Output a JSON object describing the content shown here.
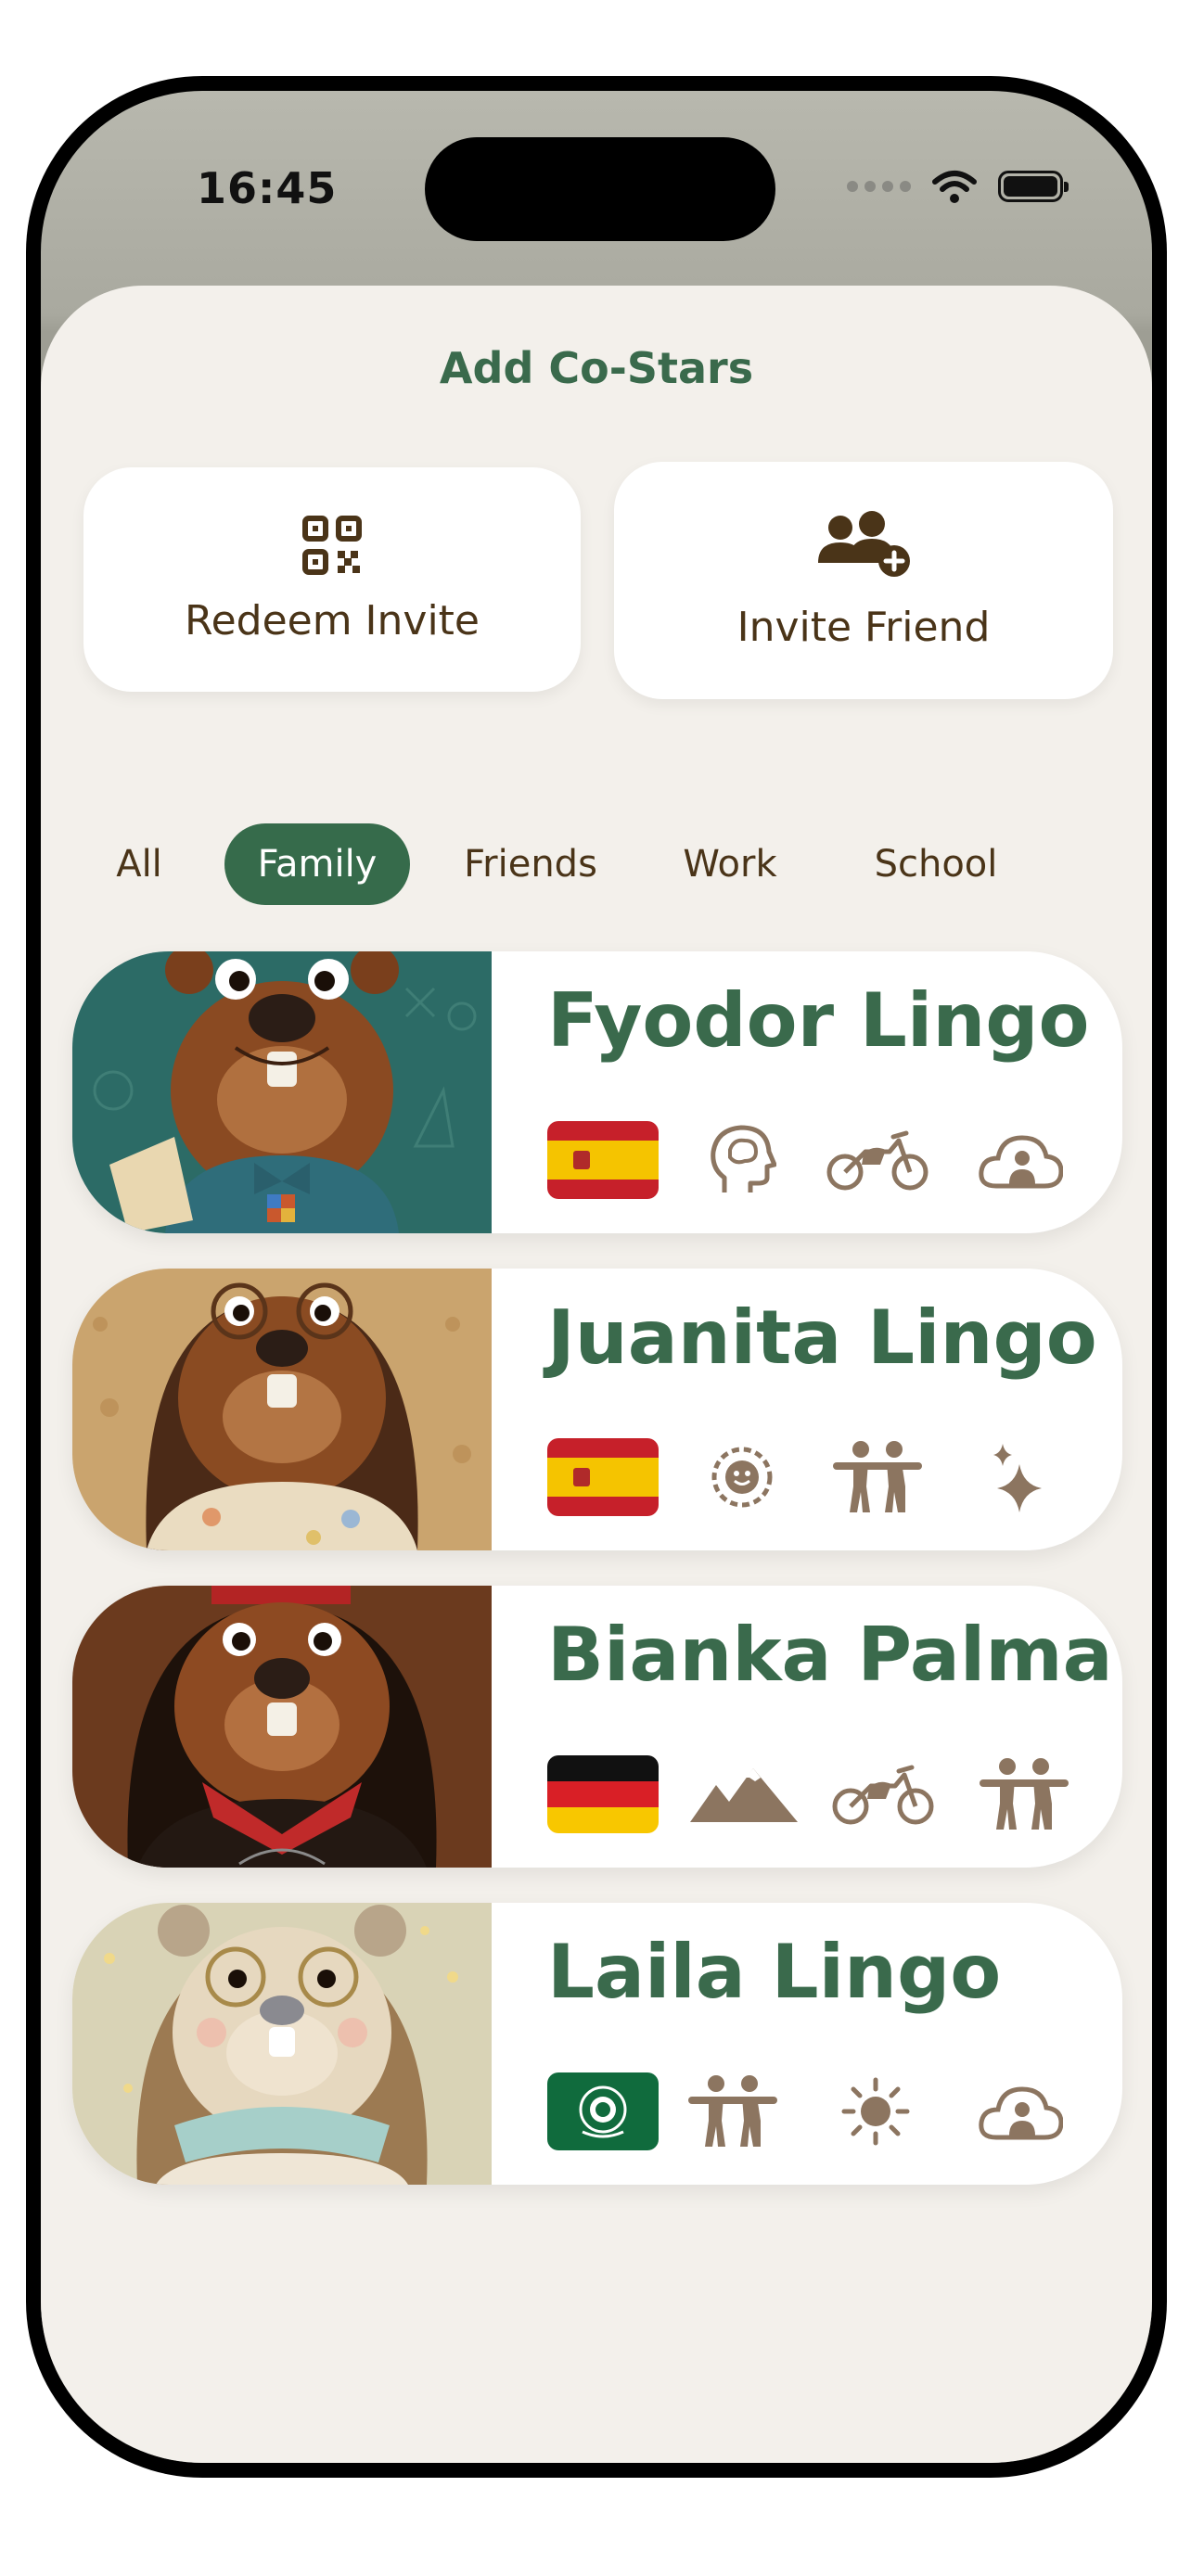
{
  "status_bar": {
    "time": "16:45"
  },
  "sheet": {
    "title": "Add Co-Stars"
  },
  "actions": {
    "redeem_label": "Redeem Invite",
    "invite_label": "Invite Friend"
  },
  "filters": [
    "All",
    "Family",
    "Friends",
    "Work",
    "School"
  ],
  "selected_filter": "Family",
  "colors": {
    "accent_green": "#366b4b",
    "title_green": "#3a6a4c",
    "text_brown": "#4a3418",
    "icon_taupe": "#8c7560",
    "sheet_bg": "#f3f0eb"
  },
  "contacts": [
    {
      "name": "Fyodor Lingo",
      "flag": "spain-flag",
      "icons": [
        "brain-head-icon",
        "motorcycle-icon",
        "cloud-person-icon"
      ]
    },
    {
      "name": "Juanita Lingo",
      "flag": "spain-flag",
      "icons": [
        "smiley-badge-icon",
        "two-people-icon",
        "sparkles-icon"
      ]
    },
    {
      "name": "Bianka Palma",
      "flag": "germany-flag",
      "icons": [
        "mountains-icon",
        "motorcycle-icon",
        "two-people-icon"
      ]
    },
    {
      "name": "Laila Lingo",
      "flag": "arab-league-flag",
      "icons": [
        "two-people-icon",
        "sun-icon",
        "cloud-person-icon"
      ]
    }
  ]
}
